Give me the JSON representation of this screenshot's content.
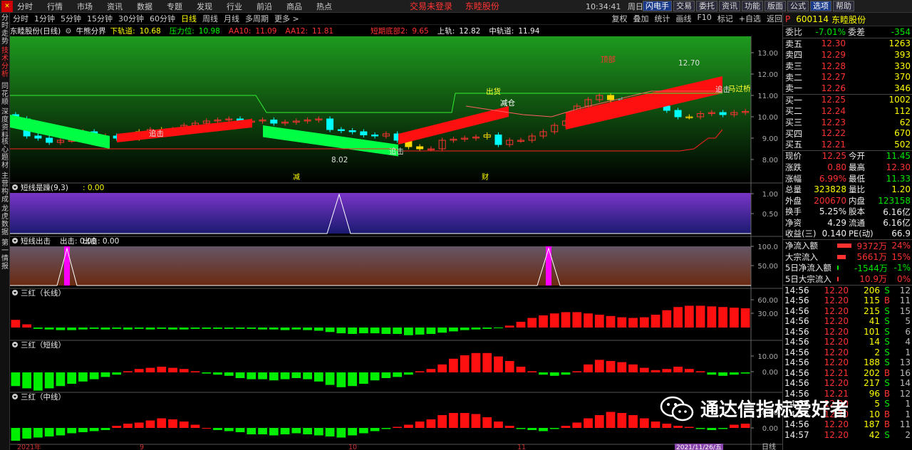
{
  "menubar": {
    "items": [
      "分时",
      "行情",
      "市场",
      "资讯",
      "数据",
      "专题",
      "发现",
      "行业",
      "前沿",
      "商品",
      "热点"
    ],
    "status": "交易未登录",
    "stock_name": "东睦股份",
    "time": "10:34:41",
    "weekday": "周日",
    "buttons": [
      "闪电手",
      "交易",
      "委托",
      "资讯",
      "功能",
      "版面",
      "公式",
      "选项",
      "帮助"
    ]
  },
  "periodbar": {
    "periods": [
      "分时",
      "1分钟",
      "5分钟",
      "15分钟",
      "30分钟",
      "60分钟",
      "日线",
      "周线",
      "月线",
      "多周期",
      "更多 >"
    ],
    "active_index": 6,
    "tools": [
      "复权",
      "叠加",
      "统计",
      "画线",
      "F10",
      "标记",
      "+自选",
      "返回"
    ]
  },
  "leftbar": [
    "分时走势",
    "技术分析",
    "同花顺",
    "深度资料",
    "核心题材",
    "主营构成",
    "龙虎数据",
    "第一情报"
  ],
  "leftbar_active": 1,
  "infobar": {
    "stock": "东睦股份(日线)",
    "indicator": "牛熊分界",
    "lower_label": "下轨道:",
    "lower_value": "10.68",
    "pressure_label": "压力位:",
    "pressure_value": "10.98",
    "aa10_label": "AA10:",
    "aa10_value": "11.09",
    "aa12_label": "AA12:",
    "aa12_value": "11.81",
    "short_bottom_label": "短期底部2:",
    "short_bottom_value": "9.65",
    "upper_label": "上轨:",
    "upper_value": "12.82",
    "mid_label": "中轨道:",
    "mid_value": "11.94"
  },
  "panels": {
    "p2": {
      "title": "短线是躁(9,3)",
      "value": ": 0.00"
    },
    "p3": {
      "title": "短线出击",
      "value": "出击: 0.00"
    },
    "p4": {
      "title": "三红（长线）"
    },
    "p5": {
      "title": "三红（短线）"
    },
    "p6": {
      "title": "三红（中线）"
    }
  },
  "annotations": {
    "high": "12.70",
    "low": "8.02",
    "buy1": "追击",
    "buy2": "追击",
    "buy3": "追击",
    "cut": "减仓",
    "out": "出货",
    "bridge": "马过桥",
    "top": "顶部",
    "mark_a": "减",
    "mark_b": "财"
  },
  "axis": {
    "p1": [
      "13.00",
      "12.00",
      "11.00",
      "10.00",
      "9.00",
      "8.00"
    ],
    "p2": [
      "1.00",
      "0.50"
    ],
    "p3": [
      "100.0",
      "50.00"
    ],
    "p4": [
      "60.00",
      "30.00"
    ],
    "p5": [
      "10.00",
      "0.00"
    ],
    "p6": [
      "10.00",
      "0.00"
    ],
    "dates": [
      "2021年",
      "9",
      "10",
      "11"
    ],
    "cursor_date": "2021/11/26/五",
    "period_label": "日线"
  },
  "colors": {
    "up": "#ff3232",
    "down": "#00ffff",
    "green": "#00ff00",
    "yellow": "#ffd700",
    "magenta": "#ff00ff"
  },
  "quote": {
    "code": "600114",
    "name": "东睦股份",
    "weibi_label": "委比",
    "weibi": "-7.01%",
    "weicha_label": "委差",
    "weicha": "-354",
    "asks": [
      {
        "label": "卖五",
        "price": "12.30",
        "vol": "1263"
      },
      {
        "label": "卖四",
        "price": "12.29",
        "vol": "393"
      },
      {
        "label": "卖三",
        "price": "12.28",
        "vol": "330"
      },
      {
        "label": "卖二",
        "price": "12.27",
        "vol": "370"
      },
      {
        "label": "卖一",
        "price": "12.26",
        "vol": "346"
      }
    ],
    "bids": [
      {
        "label": "买一",
        "price": "12.25",
        "vol": "1002"
      },
      {
        "label": "买二",
        "price": "12.24",
        "vol": "112"
      },
      {
        "label": "买三",
        "price": "12.23",
        "vol": "62"
      },
      {
        "label": "买四",
        "price": "12.22",
        "vol": "670"
      },
      {
        "label": "买五",
        "price": "12.21",
        "vol": "502"
      }
    ],
    "stats": [
      {
        "l1": "现价",
        "v1": "12.25",
        "l2": "今开",
        "v2": "11.45",
        "c1": "red",
        "c2": "green"
      },
      {
        "l1": "涨跌",
        "v1": "0.80",
        "l2": "最高",
        "v2": "12.30",
        "c1": "red",
        "c2": "red"
      },
      {
        "l1": "涨幅",
        "v1": "6.99%",
        "l2": "最低",
        "v2": "11.33",
        "c1": "red",
        "c2": "green"
      },
      {
        "l1": "总量",
        "v1": "323828",
        "l2": "量比",
        "v2": "1.20",
        "c1": "yellow",
        "c2": "yellow"
      },
      {
        "l1": "外盘",
        "v1": "200670",
        "l2": "内盘",
        "v2": "123158",
        "c1": "red",
        "c2": "green"
      },
      {
        "l1": "换手",
        "v1": "5.25%",
        "l2": "股本",
        "v2": "6.16亿",
        "c1": "white",
        "c2": "white"
      },
      {
        "l1": "净资",
        "v1": "4.29",
        "l2": "流通",
        "v2": "6.16亿",
        "c1": "white",
        "c2": "white"
      },
      {
        "l1": "收益(三)",
        "v1": "0.140",
        "l2": "PE(动)",
        "v2": "66.9",
        "c1": "white",
        "c2": "white"
      }
    ],
    "flows": [
      {
        "label": "净流入额",
        "value": "9372万",
        "pct": "24%",
        "color": "red",
        "bar": 0.9
      },
      {
        "label": "大宗流入",
        "value": "5661万",
        "pct": "15%",
        "color": "red",
        "bar": 0.55
      },
      {
        "label": "5日净流入额",
        "value": "-1544万",
        "pct": "-1%",
        "color": "green",
        "bar": 0.1
      },
      {
        "label": "5日大宗流入",
        "value": "10.9万",
        "pct": "0%",
        "color": "red",
        "bar": 0.02
      }
    ],
    "ticks": [
      {
        "t": "14:56",
        "p": "12.20",
        "v": "206",
        "d": "S",
        "n": "12"
      },
      {
        "t": "14:56",
        "p": "12.20",
        "v": "115",
        "d": "B",
        "n": "11"
      },
      {
        "t": "14:56",
        "p": "12.20",
        "v": "215",
        "d": "S",
        "n": "15"
      },
      {
        "t": "14:56",
        "p": "12.20",
        "v": "41",
        "d": "S",
        "n": "5"
      },
      {
        "t": "14:56",
        "p": "12.20",
        "v": "101",
        "d": "S",
        "n": "6"
      },
      {
        "t": "14:56",
        "p": "12.20",
        "v": "14",
        "d": "S",
        "n": "4"
      },
      {
        "t": "14:56",
        "p": "12.20",
        "v": "2",
        "d": "S",
        "n": "1"
      },
      {
        "t": "14:56",
        "p": "12.20",
        "v": "188",
        "d": "S",
        "n": "13"
      },
      {
        "t": "14:56",
        "p": "12.21",
        "v": "202",
        "d": "B",
        "n": "16"
      },
      {
        "t": "14:56",
        "p": "12.20",
        "v": "217",
        "d": "S",
        "n": "14"
      },
      {
        "t": "14:56",
        "p": "12.21",
        "v": "96",
        "d": "B",
        "n": "12"
      },
      {
        "t": "14:56",
        "p": "12.20",
        "v": "5",
        "d": "S",
        "n": "1"
      },
      {
        "t": "14:56",
        "p": "12.20",
        "v": "10",
        "d": "B",
        "n": "1"
      },
      {
        "t": "14:56",
        "p": "12.20",
        "v": "187",
        "d": "B",
        "n": "11"
      },
      {
        "t": "14:57",
        "p": "12.20",
        "v": "42",
        "d": "S",
        "n": "2"
      }
    ]
  },
  "watermark": "通达信指标爱好者"
}
